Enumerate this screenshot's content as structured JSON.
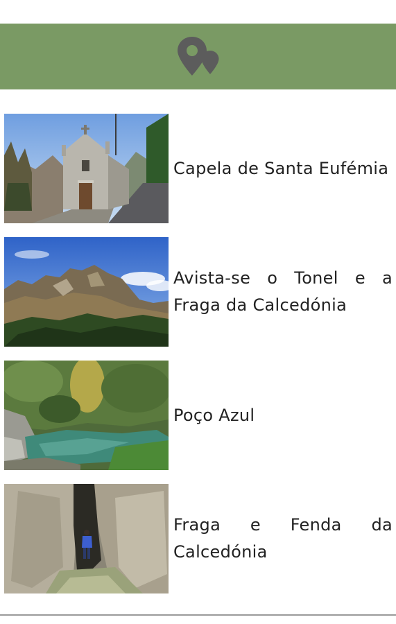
{
  "theme": {
    "header_color": "#7a9a64",
    "icon_color": "#5c5c5c"
  },
  "header": {
    "icon": "map-pins-icon"
  },
  "poi_list": [
    {
      "title": "Capela de Santa Eufémia",
      "image": "chapel-photo"
    },
    {
      "title": "Avista-se o Tonel e a Fraga da Calcedónia",
      "image": "mountain-photo"
    },
    {
      "title": "Poço Azul",
      "image": "river-pool-photo"
    },
    {
      "title": "Fraga e Fenda da Calcedónia",
      "image": "rock-crevice-photo"
    }
  ]
}
